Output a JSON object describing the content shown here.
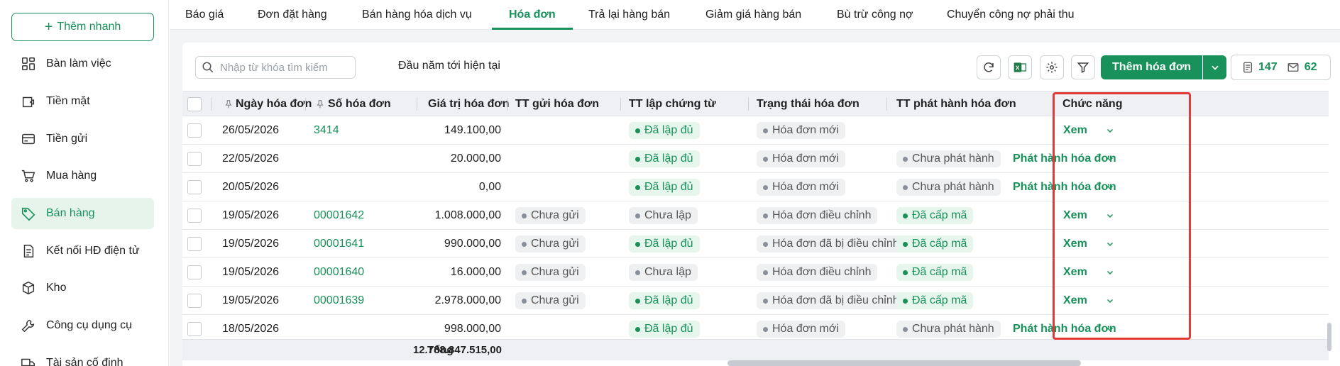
{
  "sidebar": {
    "quick_add": "Thêm nhanh",
    "items": [
      {
        "label": "Bàn làm việc",
        "icon": "dashboard-icon"
      },
      {
        "label": "Tiền mặt",
        "icon": "wallet-icon"
      },
      {
        "label": "Tiền gửi",
        "icon": "card-icon"
      },
      {
        "label": "Mua hàng",
        "icon": "cart-icon"
      },
      {
        "label": "Bán hàng",
        "icon": "tag-icon"
      },
      {
        "label": "Kết nối HĐ điện tử",
        "icon": "document-icon"
      },
      {
        "label": "Kho",
        "icon": "box-icon"
      },
      {
        "label": "Công cụ dụng cụ",
        "icon": "wrench-icon"
      },
      {
        "label": "Tài sản cố định",
        "icon": "truck-icon"
      }
    ],
    "active_index": 4
  },
  "tabs": [
    "Báo giá",
    "Đơn đặt hàng",
    "Bán hàng hóa dịch vụ",
    "Hóa đơn",
    "Trả lại hàng bán",
    "Giảm giá hàng bán",
    "Bù trừ công nợ",
    "Chuyển công nợ phải thu"
  ],
  "active_tab": 3,
  "toolbar": {
    "search_placeholder": "Nhập từ khóa tìm kiếm",
    "period": "Đầu năm tới hiện tại",
    "add_label": "Thêm hóa đơn",
    "count_docs": "147",
    "count_mail": "62"
  },
  "table": {
    "headers": {
      "date": "Ngày hóa đơn",
      "number": "Số hóa đơn",
      "value": "Giá trị hóa đơn",
      "send": "TT gửi hóa đơn",
      "voucher": "TT lập chứng từ",
      "status": "Trạng thái hóa đơn",
      "issue": "TT phát hành hóa đơn",
      "action": "Chức năng"
    },
    "rows": [
      {
        "date": "26/05/2026",
        "number": "3414",
        "value": "149.100,00",
        "send": "",
        "voucher": "Đã lập đủ",
        "status": "Hóa đơn mới",
        "issue": "",
        "action": "Xem"
      },
      {
        "date": "22/05/2026",
        "number": "",
        "value": "20.000,00",
        "send": "",
        "voucher": "Đã lập đủ",
        "status": "Hóa đơn mới",
        "issue": "Chưa phát hành",
        "action": "Phát hành hóa đơn"
      },
      {
        "date": "20/05/2026",
        "number": "",
        "value": "0,00",
        "send": "",
        "voucher": "Đã lập đủ",
        "status": "Hóa đơn mới",
        "issue": "Chưa phát hành",
        "action": "Phát hành hóa đơn"
      },
      {
        "date": "19/05/2026",
        "number": "00001642",
        "value": "1.008.000,00",
        "send": "Chưa gửi",
        "voucher": "Chưa lập",
        "status": "Hóa đơn điều chỉnh",
        "issue": "Đã cấp mã",
        "action": "Xem"
      },
      {
        "date": "19/05/2026",
        "number": "00001641",
        "value": "990.000,00",
        "send": "Chưa gửi",
        "voucher": "Đã lập đủ",
        "status": "Hóa đơn đã bị điều chỉnh",
        "issue": "Đã cấp mã",
        "action": "Xem"
      },
      {
        "date": "19/05/2026",
        "number": "00001640",
        "value": "16.000,00",
        "send": "Chưa gửi",
        "voucher": "Chưa lập",
        "status": "Hóa đơn điều chỉnh",
        "issue": "Đã cấp mã",
        "action": "Xem"
      },
      {
        "date": "19/05/2026",
        "number": "00001639",
        "value": "2.978.000,00",
        "send": "Chưa gửi",
        "voucher": "Đã lập đủ",
        "status": "Hóa đơn đã bị điều chỉnh",
        "issue": "Đã cấp mã",
        "action": "Xem"
      },
      {
        "date": "18/05/2026",
        "number": "",
        "value": "998.000,00",
        "send": "",
        "voucher": "Đã lập đủ",
        "status": "Hóa đơn mới",
        "issue": "Chưa phát hành",
        "action": "Phát hành hóa đơn"
      }
    ],
    "total_label": "Tổng",
    "total_value": "12.788.847.515,00"
  },
  "colors": {
    "accent": "#18915a",
    "highlight": "#e53935"
  }
}
